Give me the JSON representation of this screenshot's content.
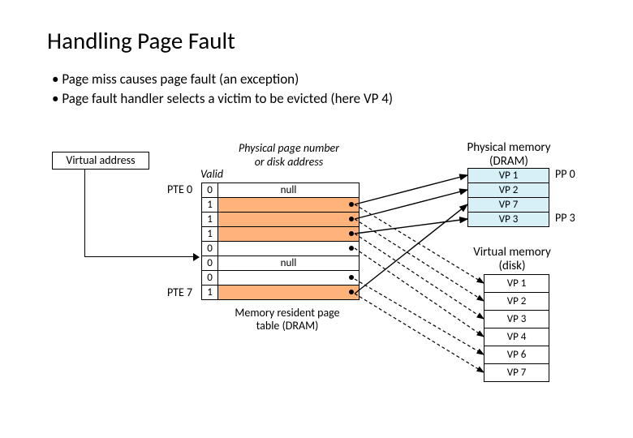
{
  "title": "Handling Page Fault",
  "bullets": [
    "Page miss causes page fault (an exception)",
    "Page fault handler selects a victim to be evicted (here VP 4)"
  ],
  "va_label": "Virtual address",
  "pt": {
    "valid_header": "Valid",
    "addr_header": "Physical page number or disk address",
    "pte0_label": "PTE 0",
    "pte7_label": "PTE 7",
    "caption": "Memory resident page table (DRAM)",
    "rows": [
      {
        "valid": "0",
        "addr": "null",
        "color": "r0"
      },
      {
        "valid": "1",
        "addr": "",
        "color": "r1"
      },
      {
        "valid": "1",
        "addr": "",
        "color": "r1"
      },
      {
        "valid": "1",
        "addr": "",
        "color": "r1"
      },
      {
        "valid": "0",
        "addr": "",
        "color": "r0"
      },
      {
        "valid": "0",
        "addr": "null",
        "color": "r0"
      },
      {
        "valid": "0",
        "addr": "",
        "color": "r0"
      },
      {
        "valid": "1",
        "addr": "",
        "color": "r1"
      }
    ]
  },
  "pm": {
    "header": "Physical memory (DRAM)",
    "rows": [
      "VP 1",
      "VP 2",
      "VP 7",
      "VP 3"
    ],
    "pp0": "PP 0",
    "pp3": "PP 3"
  },
  "vm": {
    "header": "Virtual memory (disk)",
    "rows": [
      "VP 1",
      "VP 2",
      "VP 3",
      "VP 4",
      "VP 6",
      "VP 7"
    ]
  },
  "arrows": {
    "note": "solid arrows PTE→physical mem for valid entries; dashed arrows PTE→disk for invalid-but-on-disk entries"
  }
}
